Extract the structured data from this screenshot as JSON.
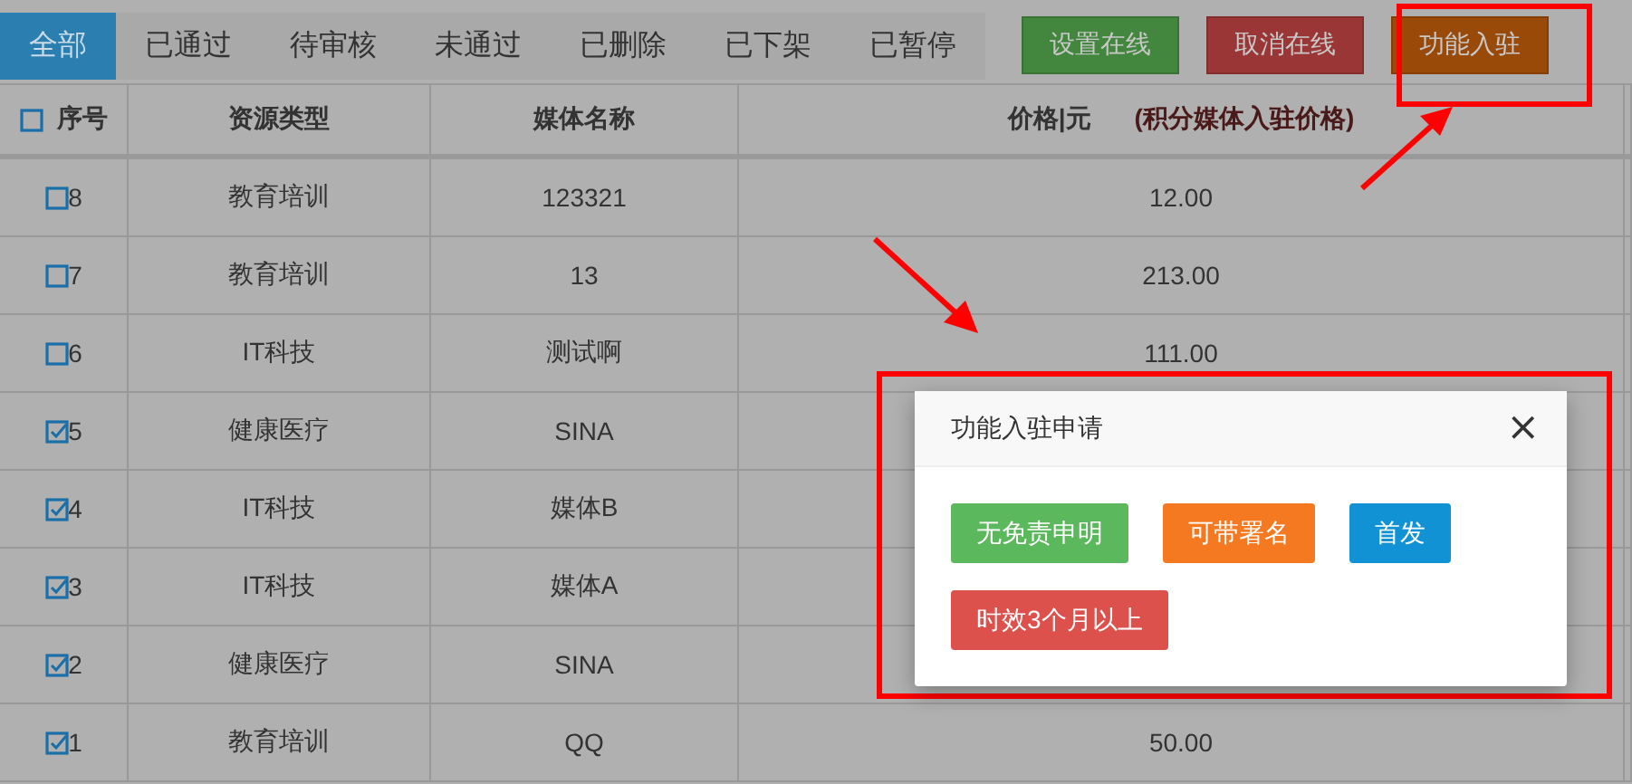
{
  "tabs": [
    {
      "label": "全部",
      "selected": true
    },
    {
      "label": "已通过",
      "selected": false
    },
    {
      "label": "待审核",
      "selected": false
    },
    {
      "label": "未通过",
      "selected": false
    },
    {
      "label": "已删除",
      "selected": false
    },
    {
      "label": "已下架",
      "selected": false
    },
    {
      "label": "已暂停",
      "selected": false
    }
  ],
  "actions": [
    {
      "label": "设置在线",
      "color": "#43873f"
    },
    {
      "label": "取消在线",
      "color": "#9a3636"
    },
    {
      "label": "功能入驻",
      "color": "#9a4a08"
    }
  ],
  "table": {
    "all_checked": false,
    "columns": [
      "序号",
      "资源类型",
      "媒体名称"
    ],
    "price_label": "价格|元",
    "price_note": "(积分媒体入驻价格)",
    "rows": [
      {
        "checked": false,
        "no": "8",
        "type": "教育培训",
        "name": "123321",
        "price": "12.00"
      },
      {
        "checked": false,
        "no": "7",
        "type": "教育培训",
        "name": "13",
        "price": "213.00"
      },
      {
        "checked": false,
        "no": "6",
        "type": "IT科技",
        "name": "测试啊",
        "price": "111.00"
      },
      {
        "checked": true,
        "no": "5",
        "type": "健康医疗",
        "name": "SINA"
      },
      {
        "checked": true,
        "no": "4",
        "type": "IT科技",
        "name": "媒体B"
      },
      {
        "checked": true,
        "no": "3",
        "type": "IT科技",
        "name": "媒体A"
      },
      {
        "checked": true,
        "no": "2",
        "type": "健康医疗",
        "name": "SINA"
      },
      {
        "checked": true,
        "no": "1",
        "type": "教育培训",
        "name": "QQ",
        "price": "50.00"
      }
    ]
  },
  "dialog": {
    "title": "功能入驻申请",
    "close": "×",
    "options": [
      {
        "label": "无免责申明",
        "color": "#5cb85c"
      },
      {
        "label": "可带署名",
        "color": "#f47920"
      },
      {
        "label": "首发",
        "color": "#1192d4"
      },
      {
        "label": "时效3个月以上",
        "color": "#dd514c"
      }
    ]
  }
}
